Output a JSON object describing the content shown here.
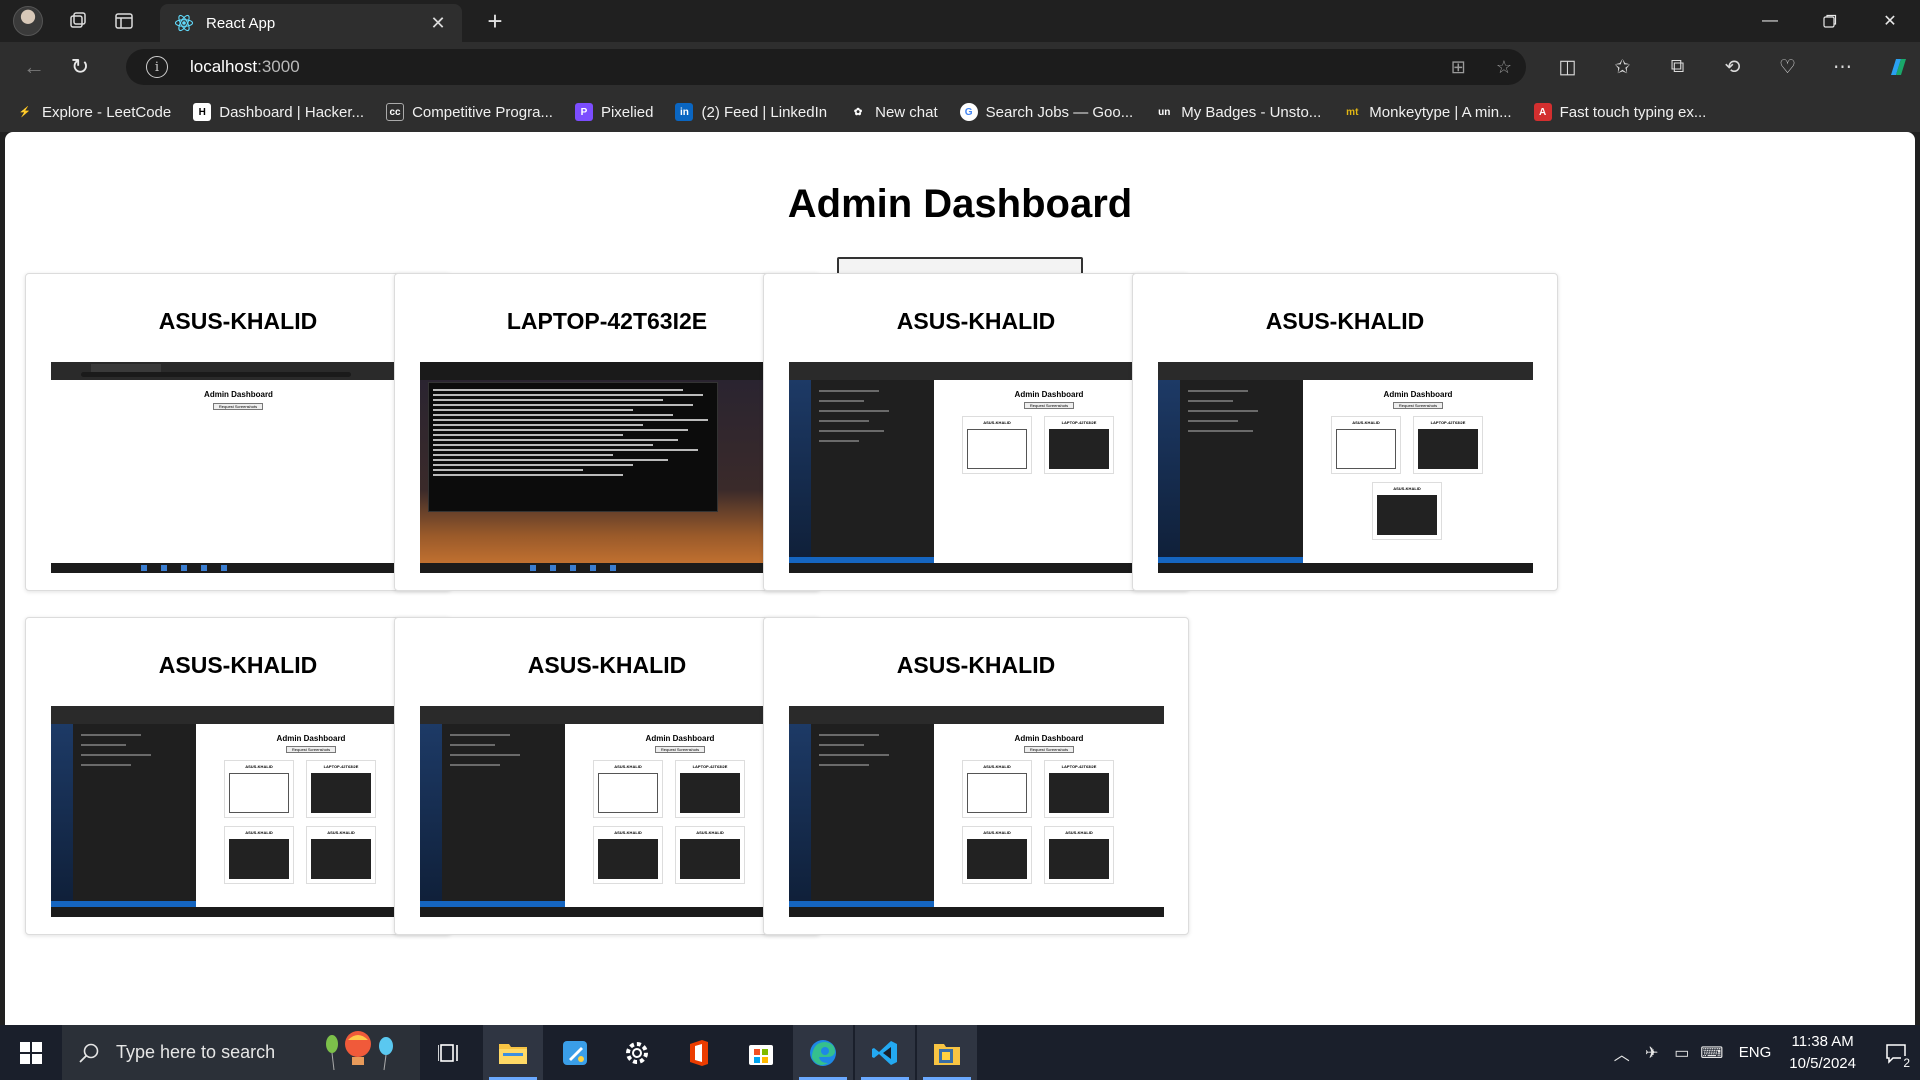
{
  "browser": {
    "tab_title": "React App",
    "url_host": "localhost",
    "url_port": ":3000",
    "bookmarks": [
      {
        "label": "Explore - LeetCode",
        "icon": "leetcode-icon",
        "color": "#1a1a1a"
      },
      {
        "label": "Dashboard | Hacker...",
        "icon": "hackerrank-icon",
        "color": "#1a1a1a"
      },
      {
        "label": "Competitive Progra...",
        "icon": "cc-icon",
        "color": "#555555"
      },
      {
        "label": "Pixelied",
        "icon": "pixelied-icon",
        "color": "#7c4dff"
      },
      {
        "label": "(2) Feed | LinkedIn",
        "icon": "linkedin-icon",
        "color": "#0a66c2"
      },
      {
        "label": "New chat",
        "icon": "openai-icon",
        "color": "#1a1a1a"
      },
      {
        "label": "Search Jobs — Goo...",
        "icon": "google-icon",
        "color": "#ffffff"
      },
      {
        "label": "My Badges - Unsto...",
        "icon": "unstop-icon",
        "color": "#1a3cff"
      },
      {
        "label": "Monkeytype | A min...",
        "icon": "monkeytype-icon",
        "color": "#e2b714"
      },
      {
        "label": "Fast touch typing ex...",
        "icon": "typing-icon",
        "color": "#d32f2f"
      }
    ]
  },
  "page": {
    "title": "Admin Dashboard",
    "request_button": "Request Screenshots",
    "cards": [
      {
        "name": "ASUS-KHALID",
        "shot": "blank-dashboard"
      },
      {
        "name": "LAPTOP-42T63I2E",
        "shot": "terminal"
      },
      {
        "name": "ASUS-KHALID",
        "shot": "vscode-2"
      },
      {
        "name": "ASUS-KHALID",
        "shot": "vscode-3"
      },
      {
        "name": "ASUS-KHALID",
        "shot": "vscode-4"
      },
      {
        "name": "ASUS-KHALID",
        "shot": "vscode-4"
      },
      {
        "name": "ASUS-KHALID",
        "shot": "vscode-4"
      }
    ],
    "mini": {
      "title": "Admin Dashboard",
      "button": "Request Screenshots",
      "c1": "ASUS-KHALID",
      "c2": "LAPTOP-42T63I2E"
    }
  },
  "taskbar": {
    "search_placeholder": "Type here to search",
    "language": "ENG",
    "time": "11:38 AM",
    "date": "10/5/2024",
    "notification_count": "2",
    "apps": [
      "task-view-icon",
      "file-explorer-icon",
      "paint-icon",
      "settings-icon",
      "office-icon",
      "store-icon",
      "edge-icon",
      "vscode-icon",
      "folder-app-icon"
    ]
  }
}
